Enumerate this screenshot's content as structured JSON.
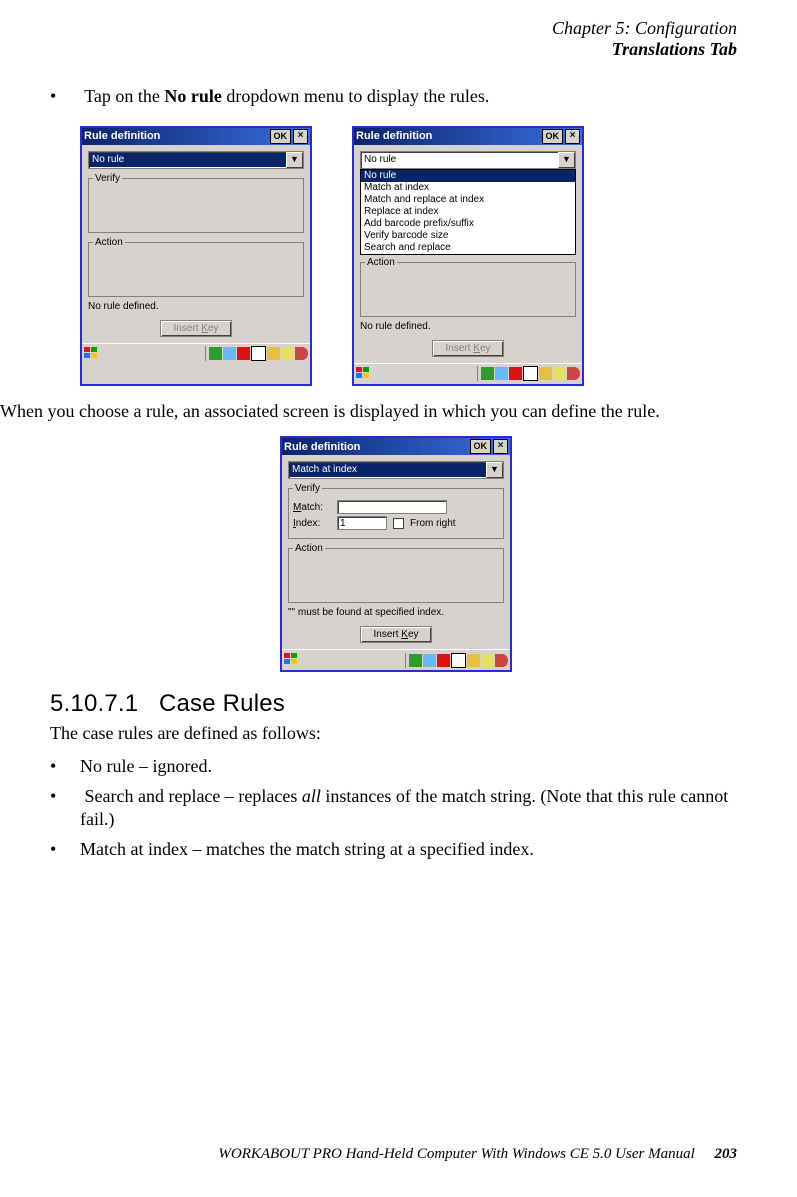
{
  "header": {
    "line1": "Chapter 5: Configuration",
    "line2": "Translations Tab"
  },
  "intro_bullet_pre": "Tap on the ",
  "intro_bullet_bold": "No rule",
  "intro_bullet_post": " dropdown menu to display the rules.",
  "win_title": "Rule definition",
  "ok_label": "OK",
  "close_glyph": "×",
  "group_verify": "Verify",
  "group_action": "Action",
  "status_no_rule": "No rule defined.",
  "insert_key_label": "Insert Key",
  "insert_key_u": "K",
  "dropdown": {
    "selected_closed": "No rule",
    "options": [
      "No rule",
      "Match at index",
      "Match and replace at index",
      "Replace at index",
      "Add barcode prefix/suffix",
      "Verify barcode size",
      "Search and replace"
    ]
  },
  "para2": "When you choose a rule, an associated screen is displayed in which you can define the rule.",
  "win3": {
    "selected": "Match at index",
    "match_label": "Match:",
    "match_u": "M",
    "index_label": "Index:",
    "index_u": "I",
    "index_value": "1",
    "from_right_label": "From right",
    "from_right_u": "F",
    "status": "\"\" must be found at specified index."
  },
  "section": {
    "num": "5.10.7.1",
    "title": "Case Rules"
  },
  "para3": "The case rules are defined as follows:",
  "bullets": {
    "b1": "No rule – ignored.",
    "b2_pre": "Search and replace – replaces ",
    "b2_it": "all",
    "b2_post": " instances of the match string. (Note that this rule cannot fail.)",
    "b3": "Match at index – matches the match string at a specified index."
  },
  "footer": {
    "text": "WORKABOUT PRO Hand-Held Computer With Windows CE 5.0 User Manual",
    "page": "203"
  }
}
